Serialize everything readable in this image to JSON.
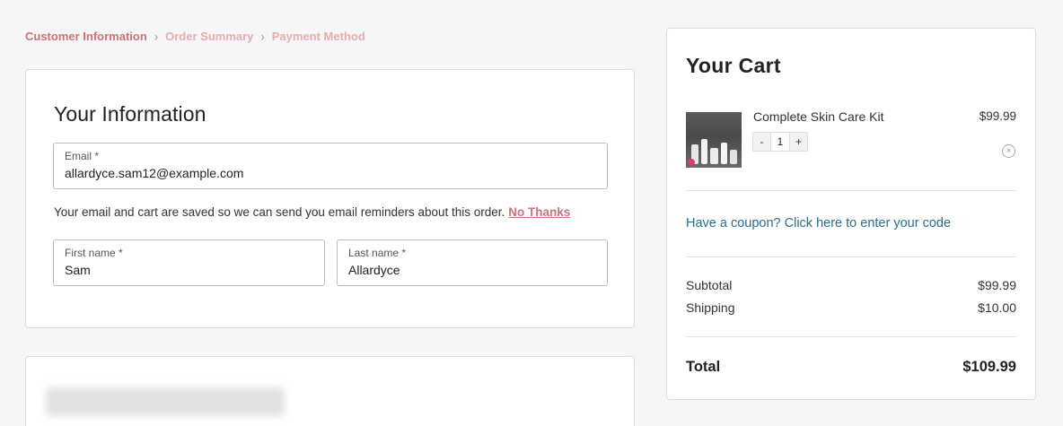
{
  "breadcrumb": {
    "steps": [
      "Customer Information",
      "Order Summary",
      "Payment Method"
    ],
    "separator": "›"
  },
  "info": {
    "title": "Your Information",
    "email_label": "Email *",
    "email_value": "allardyce.sam12@example.com",
    "notice": "Your email and cart are saved so we can send you email reminders about this order.",
    "no_thanks": "No Thanks",
    "first_name_label": "First name *",
    "first_name_value": "Sam",
    "last_name_label": "Last name *",
    "last_name_value": "Allardyce"
  },
  "cart": {
    "title": "Your Cart",
    "item": {
      "name": "Complete Skin Care Kit",
      "price": "$99.99",
      "qty": "1",
      "minus": "-",
      "plus": "+",
      "remove_icon": "×"
    },
    "coupon_link": "Have a coupon? Click here to enter your code",
    "subtotal_label": "Subtotal",
    "subtotal_value": "$99.99",
    "shipping_label": "Shipping",
    "shipping_value": "$10.00",
    "total_label": "Total",
    "total_value": "$109.99"
  },
  "colors": {
    "accent": "#c9737b",
    "accent_light": "#e6aab0",
    "link": "#2a6d8e"
  }
}
